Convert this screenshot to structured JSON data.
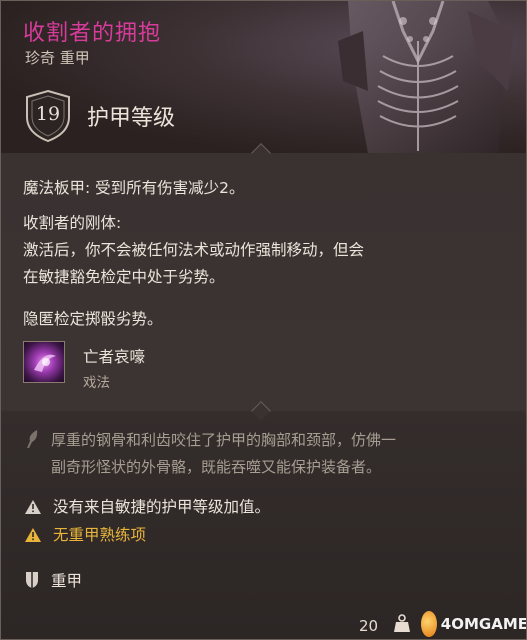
{
  "item": {
    "name": "收割者的拥抱",
    "rarity_type": "珍奇 重甲",
    "armor_class_value": "19",
    "armor_class_label": "护甲等级"
  },
  "effects": {
    "line1": "魔法板甲: 受到所有伤害减少2。",
    "line2": "收割者的刚体:",
    "line3": "激活后，你不会被任何法术或动作强制移动，但会",
    "line4": "在敏捷豁免检定中处于劣势。",
    "line5": "隐匿检定掷骰劣势。"
  },
  "spell": {
    "name": "亡者哀嚎",
    "type": "戏法"
  },
  "lore": {
    "line1": "厚重的钢骨和利齿咬住了护甲的胸部和颈部，仿佛一",
    "line2": "副奇形怪状的外骨骼，既能吞噬又能保护装备者。"
  },
  "notices": {
    "no_dex": "没有来自敏捷的护甲等级加值。",
    "no_proficiency": "无重甲熟练项"
  },
  "category": "重甲",
  "footer": {
    "weight": "20",
    "watermark": "4OMGAME"
  },
  "colors": {
    "title": "#d63c9a",
    "warning_yellow": "#e8b43a",
    "text": "#ece4da",
    "lore": "#a89d92"
  }
}
